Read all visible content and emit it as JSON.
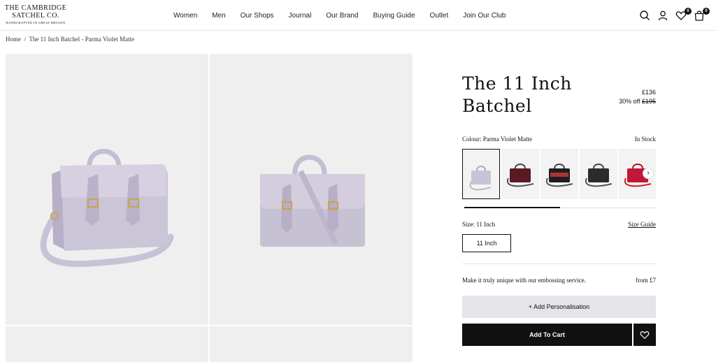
{
  "header": {
    "logo": {
      "line1": "THE CAMBRIDGE",
      "line2": "SATCHEL CO.",
      "line3": "HANDCRAFTED IN GREAT BRITAIN"
    },
    "nav": [
      "Women",
      "Men",
      "Our Shops",
      "Journal",
      "Our Brand",
      "Buying Guide",
      "Outlet",
      "Join Our Club"
    ],
    "icons": [
      "search-icon",
      "account-icon",
      "wishlist-icon",
      "bag-icon"
    ],
    "wishlist_count": "0",
    "bag_count": "0"
  },
  "breadcrumb": {
    "home": "Home",
    "separator": "/",
    "current": "The 11 Inch Batchel - Parma Violet Matte"
  },
  "product": {
    "title_line1": "The 11 Inch",
    "title_line2": "Batchel",
    "price": "£136",
    "discount": "30% off",
    "was_price": "£195",
    "colour_label": "Colour: Parma Violet Matte",
    "stock": "In Stock",
    "swatch_colors": [
      "#c9c3d6",
      "#5a1a22",
      "#1e1e1e",
      "#2b2b2b",
      "#c3173a"
    ],
    "swatch_progress": 0.5,
    "size_label": "Size: 11 Inch",
    "size_guide": "Size Guide",
    "size_option": "11 Inch",
    "emboss_text": "Make it truly unique with our embossing service.",
    "emboss_price": "from £7",
    "personalise": "+ Add Personalisation",
    "add_to_cart": "Add To Cart"
  },
  "colors": {
    "bag": "#cbc5d8",
    "bag_shade": "#b8b1c8",
    "buckle": "#c9a54a",
    "gallery_bg": "#efefef",
    "button_dark": "#111111",
    "button_light": "#e3e5e8"
  }
}
